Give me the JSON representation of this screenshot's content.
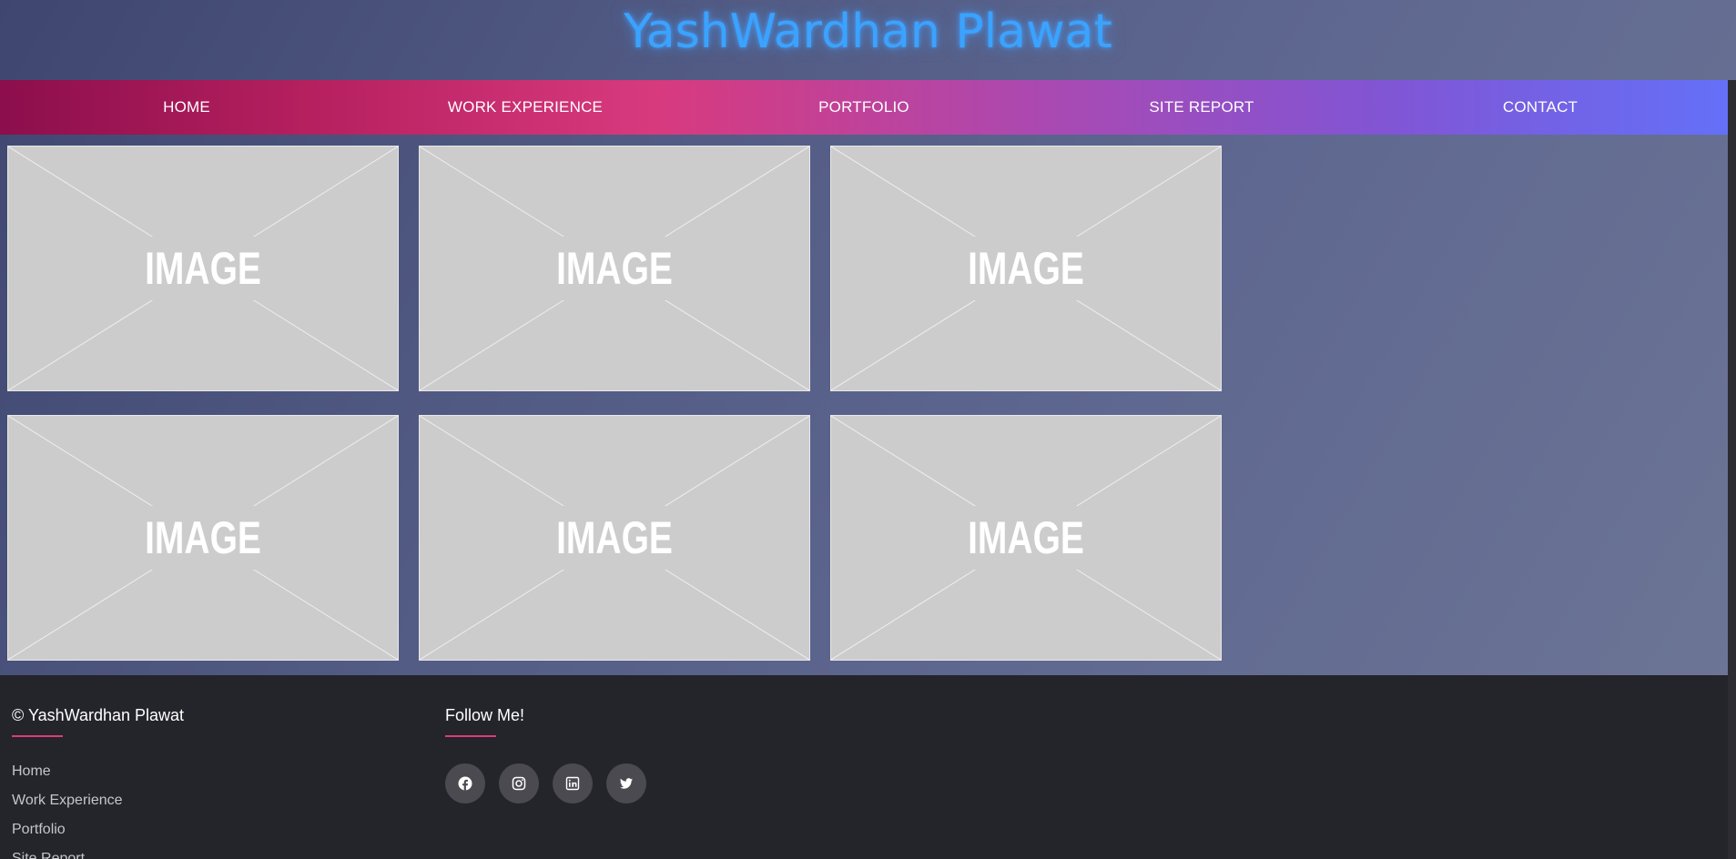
{
  "header": {
    "title": "YashWardhan Plawat"
  },
  "nav": {
    "items": [
      {
        "label": "HOME"
      },
      {
        "label": "WORK EXPERIENCE"
      },
      {
        "label": "PORTFOLIO"
      },
      {
        "label": "SITE REPORT"
      },
      {
        "label": "CONTACT"
      }
    ]
  },
  "gallery": {
    "tiles": [
      {
        "label": "IMAGE"
      },
      {
        "label": "IMAGE"
      },
      {
        "label": "IMAGE"
      },
      {
        "label": "IMAGE"
      },
      {
        "label": "IMAGE"
      },
      {
        "label": "IMAGE"
      }
    ]
  },
  "footer": {
    "copyright": "© YashWardhan Plawat",
    "links": [
      "Home",
      "Work Experience",
      "Portfolio",
      "Site Report"
    ],
    "follow_heading": "Follow Me!",
    "social": [
      {
        "icon": "facebook-icon"
      },
      {
        "icon": "instagram-icon"
      },
      {
        "icon": "linkedin-icon"
      },
      {
        "icon": "twitter-icon"
      }
    ]
  },
  "colors": {
    "title": "#3aa3ff",
    "accent": "#e03a7c",
    "footer_bg": "#24242b",
    "tile_bg": "#cccccc"
  }
}
